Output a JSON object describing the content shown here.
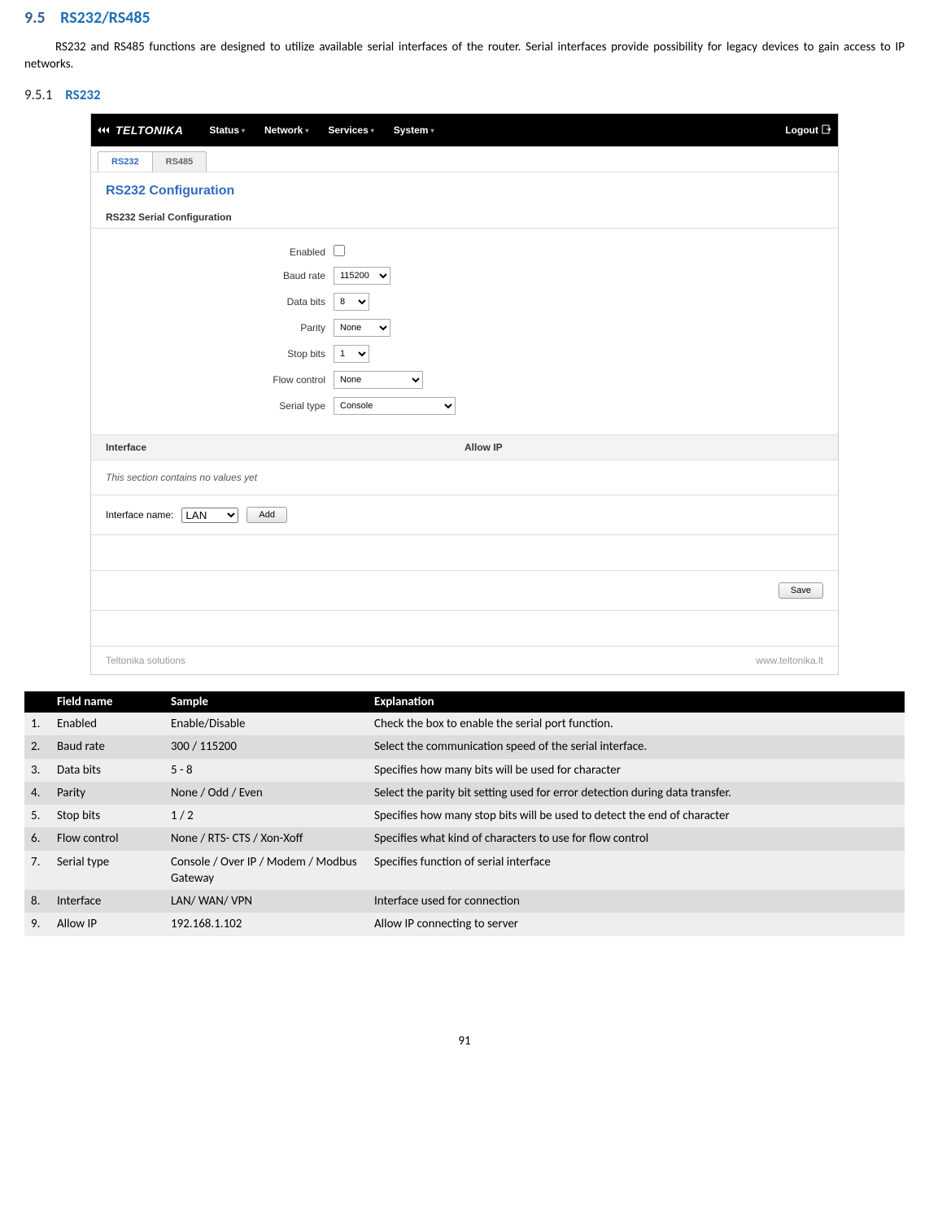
{
  "headings": {
    "h1_num": "9.5",
    "h1_text": "RS232/RS485",
    "h2_num": "9.5.1",
    "h2_text": "RS232"
  },
  "intro": "RS232 and RS485 functions are designed to utilize available serial interfaces of the router. Serial interfaces provide possibility for legacy devices to gain access to IP networks.",
  "router": {
    "brand": "TELTONIKA",
    "nav": {
      "status": "Status",
      "network": "Network",
      "services": "Services",
      "system": "System"
    },
    "logout": "Logout",
    "tabs": {
      "rs232": "RS232",
      "rs485": "RS485"
    },
    "page_title": "RS232 Configuration",
    "section_title": "RS232 Serial Configuration",
    "form": {
      "enabled_label": "Enabled",
      "baud_label": "Baud rate",
      "baud_value": "115200",
      "databits_label": "Data bits",
      "databits_value": "8",
      "parity_label": "Parity",
      "parity_value": "None",
      "stopbits_label": "Stop bits",
      "stopbits_value": "1",
      "flow_label": "Flow control",
      "flow_value": "None",
      "serialtype_label": "Serial type",
      "serialtype_value": "Console"
    },
    "iface_header": {
      "col1": "Interface",
      "col2": "Allow IP"
    },
    "no_values": "This section contains no values yet",
    "add": {
      "label": "Interface name:",
      "value": "LAN",
      "button": "Add"
    },
    "save": "Save",
    "footer_left": "Teltonika solutions",
    "footer_right": "www.teltonika.lt"
  },
  "doc_table": {
    "headers": {
      "field": "Field name",
      "sample": "Sample",
      "exp": "Explanation"
    },
    "rows": [
      {
        "n": "1.",
        "name": "Enabled",
        "sample": "Enable/Disable",
        "exp": "Check the box to enable the serial port function."
      },
      {
        "n": "2.",
        "name": "Baud rate",
        "sample": "300 / 115200",
        "exp": "Select the communication speed of the serial interface."
      },
      {
        "n": "3.",
        "name": "Data bits",
        "sample": "5 - 8",
        "exp": "Specifies how many bits will be used for character"
      },
      {
        "n": "4.",
        "name": "Parity",
        "sample": "None / Odd / Even",
        "exp": "Select the parity bit setting used for error detection during data transfer."
      },
      {
        "n": "5.",
        "name": "Stop bits",
        "sample": "1 / 2",
        "exp": "Specifies how many stop bits will be used to detect the end of character"
      },
      {
        "n": "6.",
        "name": "Flow control",
        "sample": "None / RTS- CTS / Xon-Xoff",
        "exp": "Specifies what kind of characters to use for flow control"
      },
      {
        "n": "7.",
        "name": "Serial type",
        "sample": "Console / Over IP / Modem / Modbus Gateway",
        "exp": "Specifies function of serial interface"
      },
      {
        "n": "8.",
        "name": "Interface",
        "sample": "LAN/ WAN/ VPN",
        "exp": "Interface used for connection"
      },
      {
        "n": "9.",
        "name": "Allow IP",
        "sample": "192.168.1.102",
        "exp": "Allow IP connecting to server"
      }
    ]
  },
  "page_number": "91"
}
